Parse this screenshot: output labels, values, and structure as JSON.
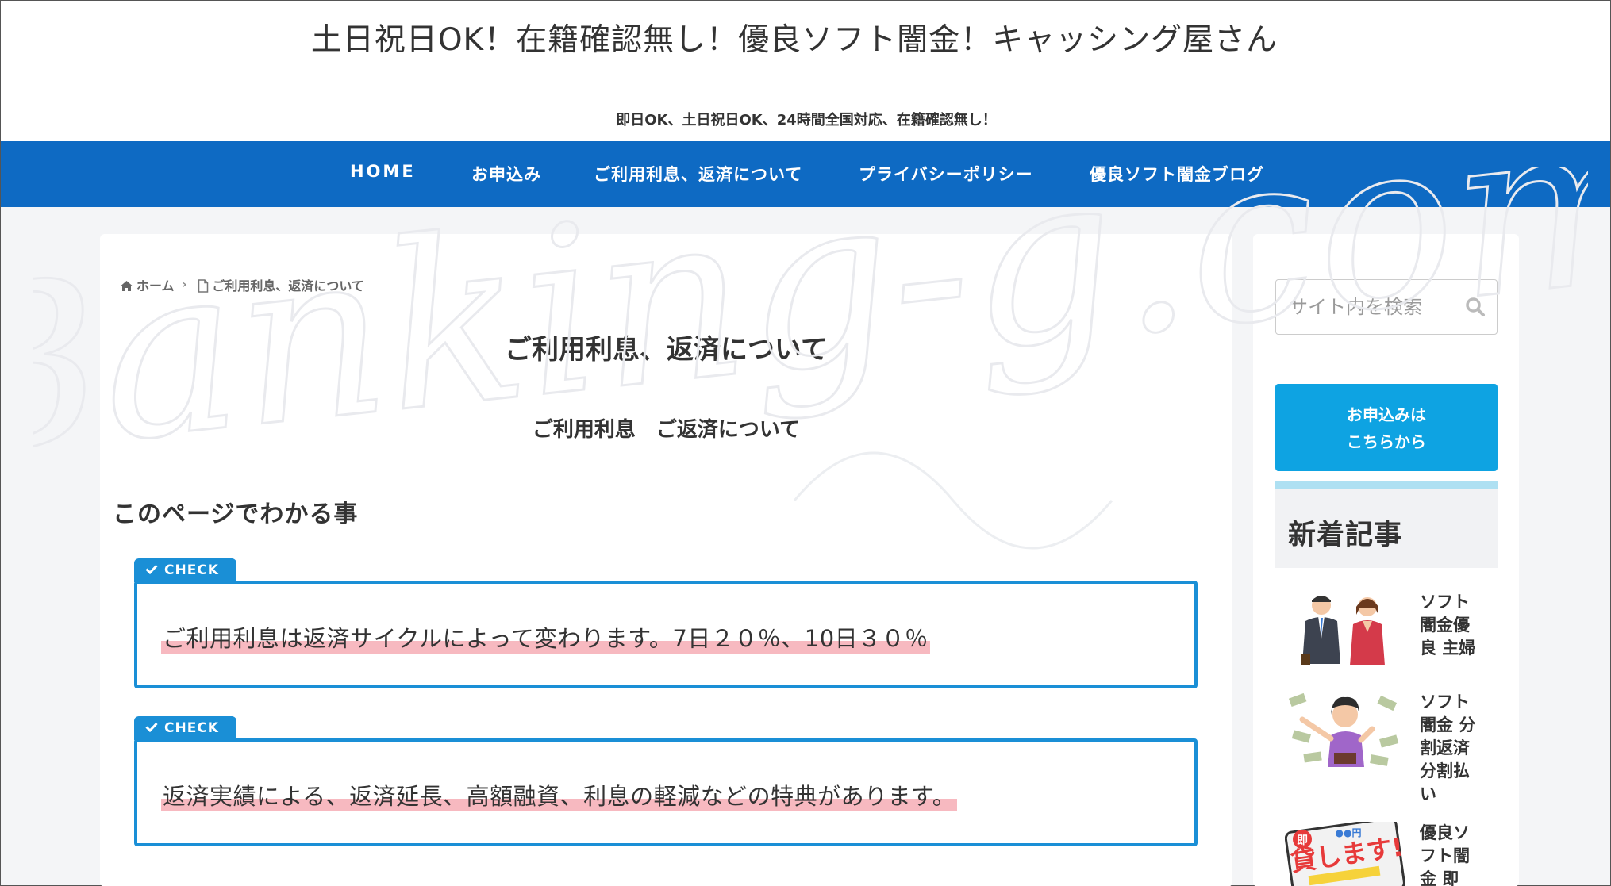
{
  "header": {
    "site_title": "土日祝日OK！在籍確認無し！優良ソフト闇金！キャッシング屋さん",
    "tagline": "即日OK、土日祝日OK、24時間全国対応、在籍確認無し！"
  },
  "nav": {
    "items": [
      {
        "label": "HOME"
      },
      {
        "label": "お申込み"
      },
      {
        "label": "ご利用利息、返済について"
      },
      {
        "label": "プライバシーポリシー"
      },
      {
        "label": "優良ソフト闇金ブログ"
      }
    ],
    "background": "#0e6ac3"
  },
  "watermark": {
    "text": "Banking-g.com"
  },
  "breadcrumb": {
    "home": "ホーム",
    "current": "ご利用利息、返済について"
  },
  "main": {
    "page_title": "ご利用利息、返済について",
    "subheading": "ご利用利息　ご返済について",
    "section_heading": "このページでわかる事",
    "checks": [
      {
        "tab": "CHECK",
        "text": "ご利用利息は返済サイクルによって変わります。7日２０％、10日３０％"
      },
      {
        "tab": "CHECK",
        "text": "返済実績による、返済延長、高額融資、利息の軽減などの特典があります。"
      }
    ],
    "accent": "#1a8fd6",
    "highlight": "#f7b9c0"
  },
  "sidebar": {
    "search_placeholder": "サイト内を検索",
    "apply_line1": "お申込みは",
    "apply_line2": "こちらから",
    "news_heading": "新着記事",
    "articles": [
      {
        "title": "ソフト闇金優良 主婦",
        "thumb": "couple-illustration"
      },
      {
        "title": "ソフト闇金 分割返済 分割払い",
        "thumb": "money-woman-illustration"
      },
      {
        "title": "優良ソフト闇金 即",
        "thumb": "lend-sign-illustration"
      }
    ]
  }
}
